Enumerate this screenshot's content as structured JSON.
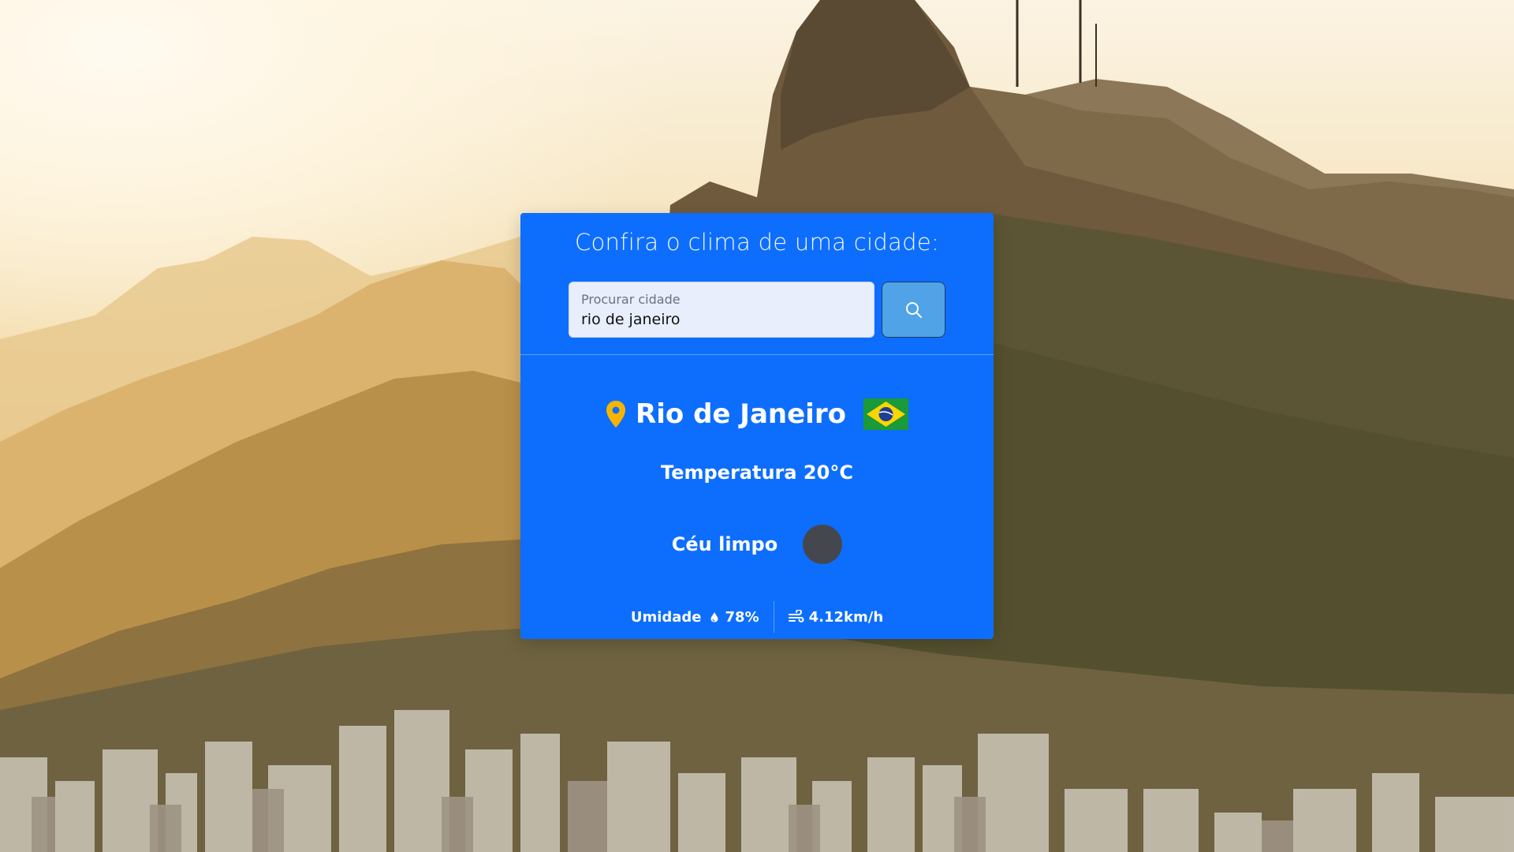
{
  "card": {
    "title": "Confira o clima de uma cidade:"
  },
  "search": {
    "label": "Procurar cidade",
    "value": "rio de janeiro",
    "button_icon": "search-icon"
  },
  "weather": {
    "city": "Rio de Janeiro",
    "location_icon": "location-pin-icon",
    "country_flag": "brazil-flag",
    "temperature": "Temperatura 20°C",
    "description": "Céu limpo",
    "condition_icon": "weather-condition-icon",
    "humidity_label": "Umidade",
    "humidity_icon": "water-drop-icon",
    "humidity_value": "78%",
    "wind_icon": "wind-icon",
    "wind_value": "4.12km/h"
  },
  "colors": {
    "card": "#0d6efd",
    "search_button": "#4fa3e6",
    "pin": "#f6b400"
  }
}
